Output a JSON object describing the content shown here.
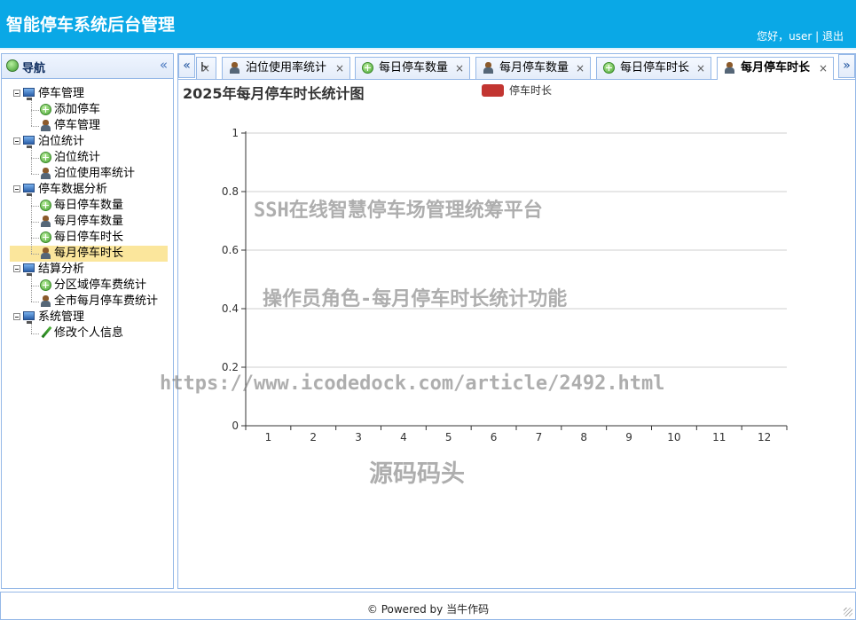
{
  "header": {
    "title": "智能停车系统后台管理",
    "greeting": "您好，user",
    "separator": "|",
    "logout": "退出",
    "bg_color": "#0aa8e6"
  },
  "sidebar": {
    "title": "导航",
    "collapse_glyph": "«",
    "groups": [
      {
        "label": "停车管理",
        "items": [
          {
            "label": "添加停车",
            "icon": "plus-circle-icon"
          },
          {
            "label": "停车管理",
            "icon": "person-icon"
          }
        ]
      },
      {
        "label": "泊位统计",
        "items": [
          {
            "label": "泊位统计",
            "icon": "plus-circle-icon"
          },
          {
            "label": "泊位使用率统计",
            "icon": "person-icon"
          }
        ]
      },
      {
        "label": "停车数据分析",
        "items": [
          {
            "label": "每日停车数量",
            "icon": "plus-circle-icon"
          },
          {
            "label": "每月停车数量",
            "icon": "person-icon"
          },
          {
            "label": "每日停车时长",
            "icon": "plus-circle-icon"
          },
          {
            "label": "每月停车时长",
            "icon": "person-icon",
            "selected": true
          }
        ]
      },
      {
        "label": "结算分析",
        "items": [
          {
            "label": "分区域停车费统计",
            "icon": "plus-circle-icon"
          },
          {
            "label": "全市每月停车费统计",
            "icon": "person-icon"
          }
        ]
      },
      {
        "label": "系统管理",
        "items": [
          {
            "label": "修改个人信息",
            "icon": "pencil-icon"
          }
        ]
      }
    ]
  },
  "tabs": {
    "scroll_left": "«",
    "scroll_right": "»",
    "items": [
      {
        "label": "ト",
        "icon": "none",
        "close": "×"
      },
      {
        "label": "泊位使用率统计",
        "icon": "person-icon",
        "close": "×"
      },
      {
        "label": "每日停车数量",
        "icon": "plus-circle-icon",
        "close": "×"
      },
      {
        "label": "每月停车数量",
        "icon": "person-icon",
        "close": "×"
      },
      {
        "label": "每日停车时长",
        "icon": "plus-circle-icon",
        "close": "×"
      },
      {
        "label": "每月停车时长",
        "icon": "person-icon",
        "close": "×",
        "active": true
      }
    ]
  },
  "chart_data": {
    "type": "bar",
    "title": "2025年每月停车时长统计图",
    "categories": [
      "1",
      "2",
      "3",
      "4",
      "5",
      "6",
      "7",
      "8",
      "9",
      "10",
      "11",
      "12"
    ],
    "series": [
      {
        "name": "停车时长",
        "values": [],
        "color": "#c23531"
      }
    ],
    "y_ticks": [
      "0",
      "0.2",
      "0.4",
      "0.6",
      "0.8",
      "1"
    ],
    "ylim": [
      0,
      1
    ],
    "grid": true,
    "legend_position": "top-center"
  },
  "watermarks": {
    "line1": "SSH在线智慧停车场管理统筹平台",
    "line2": "操作员角色-每月停车时长统计功能",
    "line3": "https://www.icodedock.com/article/2492.html",
    "line4": "源码码头"
  },
  "footer": {
    "text": "© Powered by 当牛作码"
  }
}
